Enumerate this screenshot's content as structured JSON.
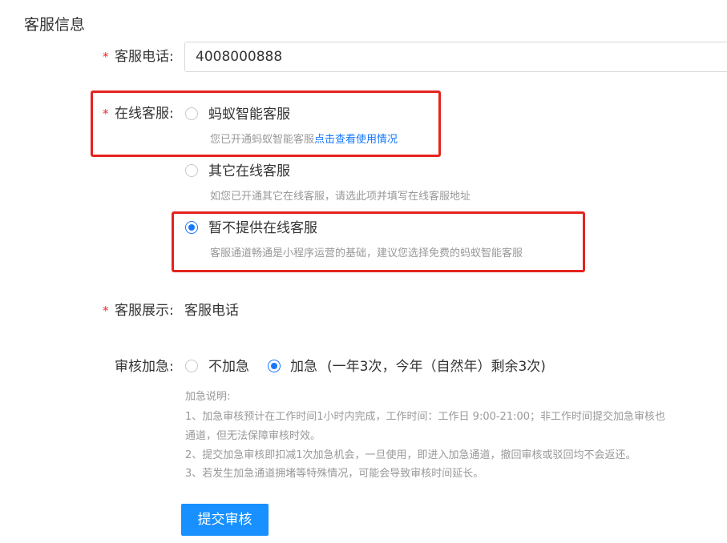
{
  "section_title": "客服信息",
  "phone": {
    "required_mark": "*",
    "label": "客服电话:",
    "value": "4008000888"
  },
  "online_service": {
    "required_mark": "*",
    "label": "在线客服:",
    "options": [
      {
        "label": "蚂蚁智能客服",
        "hint": "您已开通蚂蚁智能客服",
        "hint_link": "点击查看使用情况",
        "checked": false
      },
      {
        "label": "其它在线客服",
        "hint": "如您已开通其它在线客服，请选此项并填写在线客服地址",
        "checked": false
      },
      {
        "label": "暂不提供在线客服",
        "hint": "客服通道畅通是小程序运营的基础，建议您选择免费的蚂蚁智能客服",
        "checked": true
      }
    ]
  },
  "display": {
    "required_mark": "*",
    "label": "客服展示:",
    "value": "客服电话"
  },
  "urgent": {
    "label": "审核加急:",
    "options": [
      {
        "label": "不加急",
        "checked": false
      },
      {
        "label": "加急",
        "checked": true
      }
    ],
    "quota_text": "(一年3次，今年（自然年）剩余3次)",
    "notes": [
      "加急说明:",
      "1、加急审核预计在工作时间1小时内完成，工作时间：工作日 9:00-21:00；非工作时间提交加急审核也",
      "通道，但无法保障审核时效。",
      "2、提交加急审核即扣减1次加急机会，一旦使用，即进入加急通道，撤回审核或驳回均不会返还。",
      "3、若发生加急通道拥堵等特殊情况，可能会导致审核时间延长。"
    ]
  },
  "submit_label": "提交审核",
  "colors": {
    "accent": "#1677ff",
    "required": "#f5222d",
    "highlight_box": "#e5231d",
    "hint": "#999999"
  }
}
